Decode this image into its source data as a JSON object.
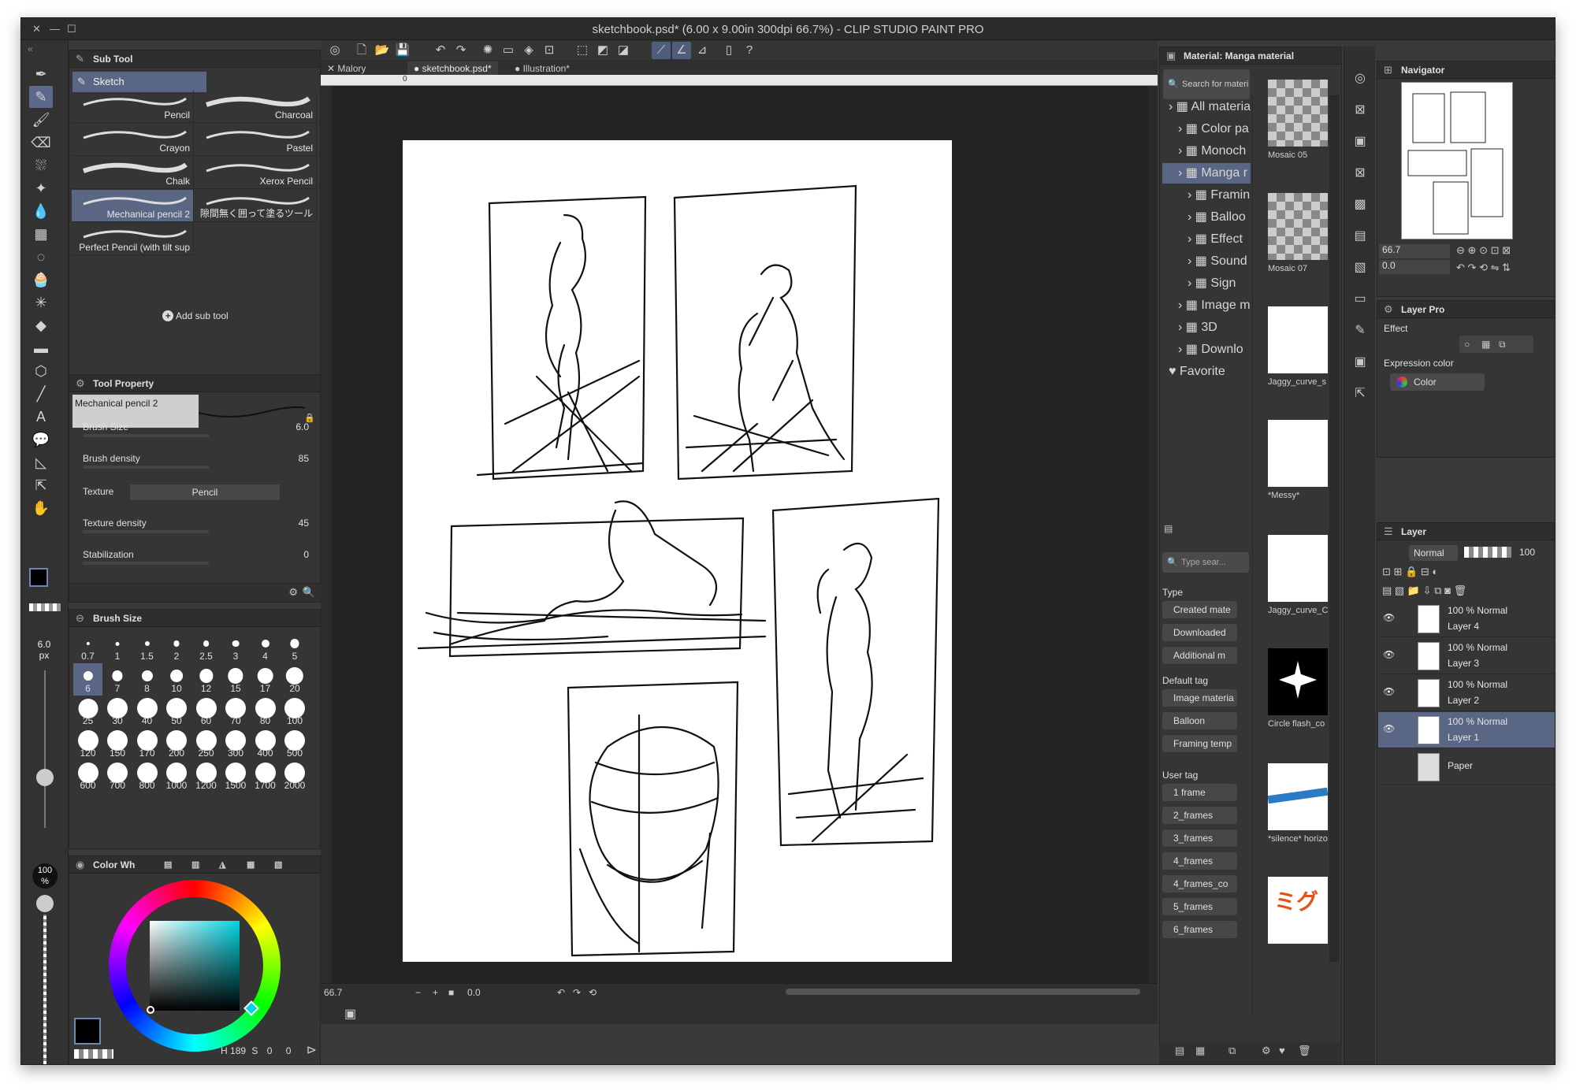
{
  "window": {
    "title": "sketchbook.psd* (6.00 x 9.00in 300dpi 66.7%)  - CLIP STUDIO PAINT PRO"
  },
  "doc_tabs": [
    {
      "label": "Malory",
      "active": false
    },
    {
      "label": "sketchbook.psd*",
      "active": true
    },
    {
      "label": "Illustration*",
      "active": false
    }
  ],
  "ruler": {
    "zero": "0"
  },
  "sub_tool": {
    "header": "Sub Tool",
    "group": "Sketch",
    "brushes": [
      {
        "label": "Pencil"
      },
      {
        "label": "Charcoal"
      },
      {
        "label": "Crayon"
      },
      {
        "label": "Pastel"
      },
      {
        "label": "Chalk"
      },
      {
        "label": "Xerox Pencil"
      },
      {
        "label": "Mechanical pencil 2"
      },
      {
        "label": "隙間無く囲って塗るツール"
      },
      {
        "label": "Perfect Pencil (with tilt sup"
      }
    ],
    "add_label": "Add sub tool"
  },
  "tool_property": {
    "header": "Tool Property",
    "brush_name": "Mechanical pencil 2",
    "rows": [
      {
        "label": "Brush Size",
        "value": "6.0"
      },
      {
        "label": "Brush density",
        "value": "85"
      },
      {
        "label": "Texture",
        "value": "Pencil"
      },
      {
        "label": "Texture density",
        "value": "45"
      },
      {
        "label": "Stabilization",
        "value": "0"
      }
    ]
  },
  "brush_size": {
    "header": "Brush Size",
    "sizes": [
      "0.7",
      "1",
      "1.5",
      "2",
      "2.5",
      "3",
      "4",
      "5",
      "6",
      "7",
      "8",
      "10",
      "12",
      "15",
      "17",
      "20",
      "25",
      "30",
      "40",
      "50",
      "60",
      "70",
      "80",
      "100",
      "120",
      "150",
      "170",
      "200",
      "250",
      "300",
      "400",
      "500",
      "600",
      "700",
      "800",
      "1000",
      "1200",
      "1500",
      "1700",
      "2000"
    ],
    "current_size": "6.0",
    "current_unit": "px",
    "opacity_value": "100",
    "opacity_unit": "%"
  },
  "color_wheel": {
    "header": "Color Wh",
    "status_left": "189",
    "status_mid": "0",
    "status_right": "0"
  },
  "canvas_status": {
    "zoom": "66.7",
    "angle": "0.0"
  },
  "material": {
    "header": "Material: Manga material",
    "search_placeholder": "Search for materi",
    "tree": [
      {
        "label": "All materia",
        "indent": 0,
        "selected": false
      },
      {
        "label": "Color pa",
        "indent": 1,
        "selected": false
      },
      {
        "label": "Monoch",
        "indent": 1,
        "selected": false
      },
      {
        "label": "Manga r",
        "indent": 1,
        "selected": true
      },
      {
        "label": "Framin",
        "indent": 2,
        "selected": false
      },
      {
        "label": "Balloo",
        "indent": 2,
        "selected": false
      },
      {
        "label": "Effect",
        "indent": 2,
        "selected": false
      },
      {
        "label": "Sound",
        "indent": 2,
        "selected": false
      },
      {
        "label": "Sign",
        "indent": 2,
        "selected": false
      },
      {
        "label": "Image m",
        "indent": 1,
        "selected": false
      },
      {
        "label": "3D",
        "indent": 1,
        "selected": false
      },
      {
        "label": "Downlo",
        "indent": 1,
        "selected": false
      },
      {
        "label": "Favorite",
        "indent": 0,
        "selected": false
      }
    ],
    "tag_search_placeholder": "Type sear...",
    "type_heading": "Type",
    "type_tags": [
      "Created mate",
      "Downloaded",
      "Additional m"
    ],
    "default_heading": "Default tag",
    "default_tags": [
      "Image materia",
      "Balloon",
      "Framing temp"
    ],
    "user_heading": "User tag",
    "user_tags": [
      "1 frame",
      "2_frames",
      "3_frames",
      "4_frames",
      "4_frames_co",
      "5_frames",
      "6_frames"
    ],
    "thumbnails": [
      "Mosaic 05",
      "Mosaic 07",
      "Jaggy_curve_s",
      "*Messy*",
      "Jaggy_curve_C",
      "Circle flash_co",
      "*silence* horizo",
      ""
    ]
  },
  "navigator": {
    "header": "Navigator",
    "zoom": "66.7",
    "angle": "0.0"
  },
  "layer_property": {
    "header": "Layer Pro",
    "effect_label": "Effect",
    "expression_label": "Expression color",
    "expression_value": "Color"
  },
  "layers": {
    "header": "Layer",
    "blend_mode": "Normal",
    "opacity": "100",
    "items": [
      {
        "mode": "100 %  Normal",
        "name": "Layer 4",
        "selected": false
      },
      {
        "mode": "100 %  Normal",
        "name": "Layer 3",
        "selected": false
      },
      {
        "mode": "100 %  Normal",
        "name": "Layer 2",
        "selected": false
      },
      {
        "mode": "100 %  Normal",
        "name": "Layer 1",
        "selected": true
      },
      {
        "mode": "",
        "name": "Paper",
        "selected": false
      }
    ]
  },
  "colors": {
    "accent": "#5a6784",
    "panel": "#353535",
    "canvas_bg": "#232323"
  }
}
